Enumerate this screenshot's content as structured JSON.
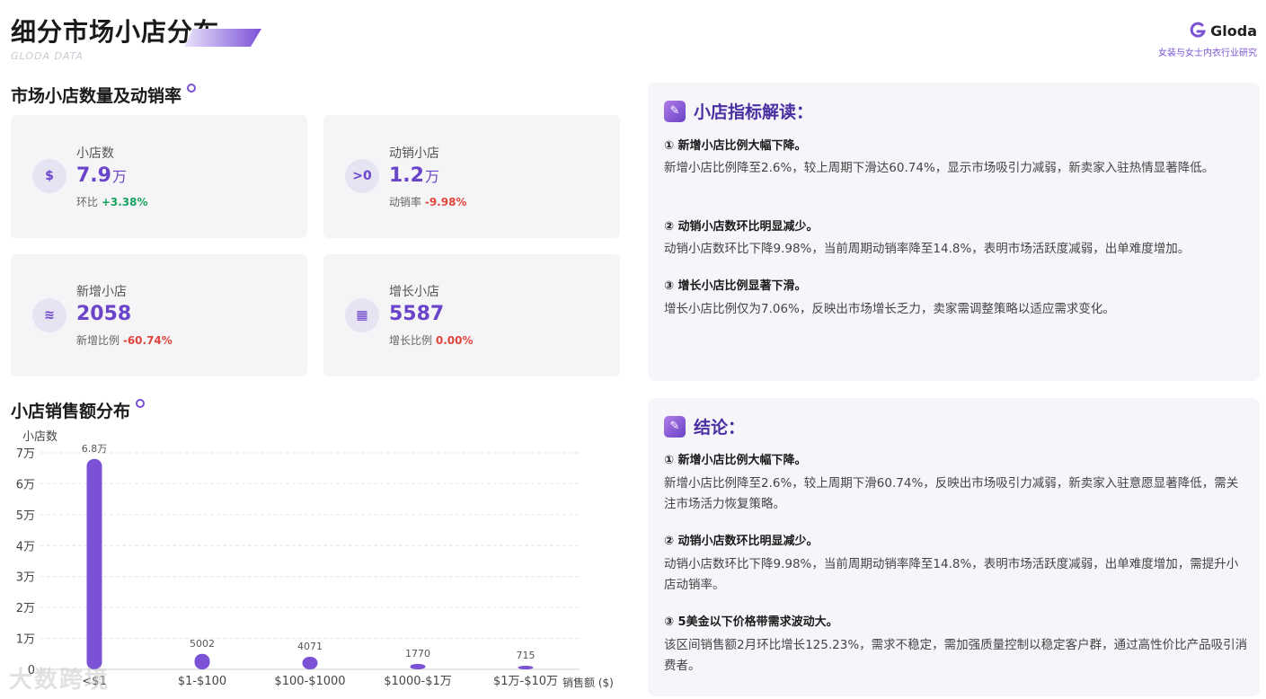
{
  "header": {
    "title": "细分市场小店分布",
    "subtitle": "GLODA DATA",
    "brand_name": "Gloda",
    "brand_sub": "女装与女士内衣行业研究"
  },
  "sections": {
    "metrics_title": "市场小店数量及动销率",
    "chart_title": "小店销售额分布"
  },
  "cards": [
    {
      "icon": "money-bag-icon",
      "glyph": "$",
      "label": "小店数",
      "value": "7.9",
      "unit": "万",
      "sub_label": "环比",
      "sub_value": "+3.38%"
    },
    {
      "icon": "greater-than-zero-icon",
      "glyph": ">0",
      "label": "动销小店",
      "value": "1.2",
      "unit": "万",
      "sub_label": "动销率",
      "sub_value": "-9.98%"
    },
    {
      "icon": "layers-icon",
      "glyph": "≋",
      "label": "新增小店",
      "value": "2058",
      "unit": "",
      "sub_label": "新增比例",
      "sub_value": "-60.74%"
    },
    {
      "icon": "grid-icon",
      "glyph": "▦",
      "label": "增长小店",
      "value": "5587",
      "unit": "",
      "sub_label": "增长比例",
      "sub_value": "0.00%"
    }
  ],
  "insights": {
    "title": "小店指标解读：",
    "points": [
      {
        "head": "① 新增小店比例大幅下降。",
        "body": "新增小店比例降至2.6%，较上周期下滑达60.74%，显示市场吸引力减弱，新卖家入驻热情显著降低。"
      },
      {
        "head": "② 动销小店数环比明显减少。",
        "body": "动销小店数环比下降9.98%，当前周期动销率降至14.8%，表明市场活跃度减弱，出单难度增加。"
      },
      {
        "head": "③ 增长小店比例显著下滑。",
        "body": "增长小店比例仅为7.06%，反映出市场增长乏力，卖家需调整策略以适应需求变化。"
      }
    ]
  },
  "conclusion": {
    "title": "结论：",
    "points": [
      {
        "head": "① 新增小店比例大幅下降。",
        "body": "新增小店比例降至2.6%，较上周期下滑60.74%，反映出市场吸引力减弱，新卖家入驻意愿显著降低，需关注市场活力恢复策略。"
      },
      {
        "head": "② 动销小店数环比明显减少。",
        "body": "动销小店数环比下降9.98%，当前周期动销率降至14.8%，表明市场活跃度减弱，出单难度增加，需提升小店动销率。"
      },
      {
        "head": "③ 5美金以下价格带需求波动大。",
        "body": "该区间销售额2月环比增长125.23%，需求不稳定，需加强质量控制以稳定客户群，通过高性价比产品吸引消费者。"
      }
    ]
  },
  "watermark": "大数跨境",
  "chart_data": {
    "type": "bar",
    "title": "",
    "ylabel": "小店数",
    "xlabel": "销售额 ($)",
    "categories": [
      "<$1",
      "$1-$100",
      "$100-$1000",
      "$1000-$1万",
      "$1万-$10万"
    ],
    "values": [
      68000,
      5002,
      4071,
      1770,
      715
    ],
    "data_labels": [
      "6.8万",
      "5002",
      "4071",
      "1770",
      "715"
    ],
    "ylim": [
      0,
      70000
    ],
    "yticks": [
      0,
      10000,
      20000,
      30000,
      40000,
      50000,
      60000,
      70000
    ],
    "ytick_labels": [
      "0",
      "1万",
      "2万",
      "3万",
      "4万",
      "5万",
      "6万",
      "7万"
    ],
    "grid": true,
    "color": "#7b52d6"
  }
}
